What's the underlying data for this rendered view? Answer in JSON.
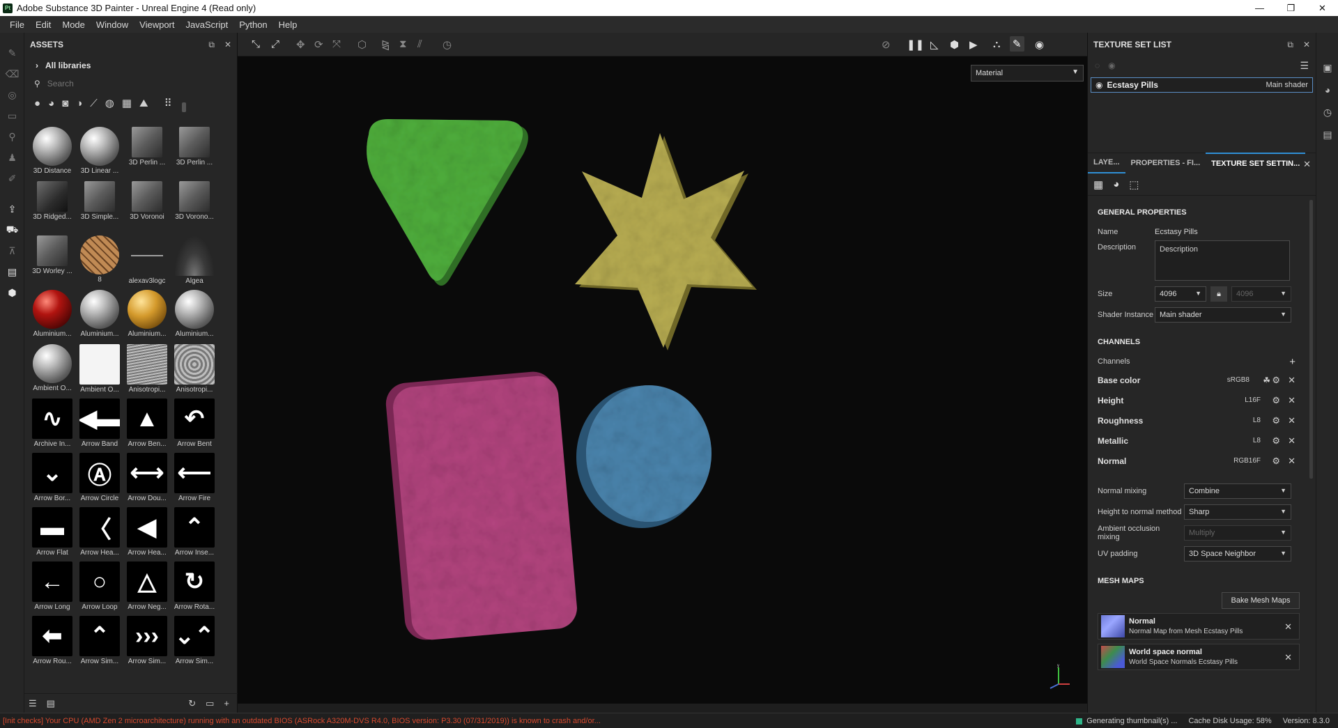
{
  "window": {
    "title": "Adobe Substance 3D Painter - Unreal Engine 4 (Read only)",
    "app_icon_text": "Pt"
  },
  "menu": [
    "File",
    "Edit",
    "Mode",
    "Window",
    "Viewport",
    "JavaScript",
    "Python",
    "Help"
  ],
  "assets": {
    "title": "ASSETS",
    "libraries_label": "All libraries",
    "search_placeholder": "Search",
    "items": [
      {
        "label": "3D Distance",
        "style": "sphere-chrome"
      },
      {
        "label": "3D Linear ...",
        "style": "sphere-chrome"
      },
      {
        "label": "3D Perlin ...",
        "style": "cube"
      },
      {
        "label": "3D Perlin ...",
        "style": "cube"
      },
      {
        "label": "3D Ridged...",
        "style": "cube dark"
      },
      {
        "label": "3D Simple...",
        "style": "cube"
      },
      {
        "label": "3D Voronoi",
        "style": "cube"
      },
      {
        "label": "3D Vorono...",
        "style": "cube"
      },
      {
        "label": "3D Worley ...",
        "style": "cube"
      },
      {
        "label": "8",
        "style": "sphere-diamond"
      },
      {
        "label": "alexav3logc",
        "style": "line"
      },
      {
        "label": "Algea",
        "style": "algea"
      },
      {
        "label": "Aluminium...",
        "style": "sphere-red"
      },
      {
        "label": "Aluminium...",
        "style": "sphere-chrome"
      },
      {
        "label": "Aluminium...",
        "style": "sphere-gold"
      },
      {
        "label": "Aluminium...",
        "style": "sphere-chrome"
      },
      {
        "label": "Ambient O...",
        "style": "sphere-chrome"
      },
      {
        "label": "Ambient O...",
        "style": "mask"
      },
      {
        "label": "Anisotropi...",
        "style": "lines"
      },
      {
        "label": "Anisotropi...",
        "style": "ring"
      },
      {
        "label": "Archive In...",
        "style": "white-shape",
        "glyph": "∿"
      },
      {
        "label": "Arrow Band",
        "style": "white-shape",
        "glyph": "◀▬"
      },
      {
        "label": "Arrow Ben...",
        "style": "white-shape",
        "glyph": "▲"
      },
      {
        "label": "Arrow Bent",
        "style": "white-shape",
        "glyph": "↶"
      },
      {
        "label": "Arrow Bor...",
        "style": "white-shape",
        "glyph": "⌄"
      },
      {
        "label": "Arrow Circle",
        "style": "white-shape",
        "glyph": "Ⓐ"
      },
      {
        "label": "Arrow Dou...",
        "style": "white-shape",
        "glyph": "⟷"
      },
      {
        "label": "Arrow Fire",
        "style": "white-shape",
        "glyph": "⟵"
      },
      {
        "label": "Arrow Flat",
        "style": "white-shape",
        "glyph": "▬"
      },
      {
        "label": "Arrow Hea...",
        "style": "white-shape",
        "glyph": "〈"
      },
      {
        "label": "Arrow Hea...",
        "style": "white-shape",
        "glyph": "◀"
      },
      {
        "label": "Arrow Inse...",
        "style": "white-shape",
        "glyph": "⌃"
      },
      {
        "label": "Arrow Long",
        "style": "white-shape",
        "glyph": "←"
      },
      {
        "label": "Arrow Loop",
        "style": "white-shape",
        "glyph": "○"
      },
      {
        "label": "Arrow Neg...",
        "style": "white-shape",
        "glyph": "△"
      },
      {
        "label": "Arrow Rota...",
        "style": "white-shape",
        "glyph": "↻"
      },
      {
        "label": "Arrow Rou...",
        "style": "white-shape",
        "glyph": "⬅"
      },
      {
        "label": "Arrow Sim...",
        "style": "white-shape",
        "glyph": "⌃"
      },
      {
        "label": "Arrow Sim...",
        "style": "white-shape",
        "glyph": "›››"
      },
      {
        "label": "Arrow Sim...",
        "style": "white-shape",
        "glyph": "⌄⌃"
      }
    ]
  },
  "viewport": {
    "mode": "Material"
  },
  "texture_set_list": {
    "title": "TEXTURE SET LIST",
    "set_name": "Ecstasy Pills",
    "set_shader": "Main shader"
  },
  "tabs": {
    "layers": "LAYE...",
    "properties": "PROPERTIES - FI...",
    "texture_set_settings": "TEXTURE SET SETTIN..."
  },
  "general": {
    "section": "GENERAL PROPERTIES",
    "name_label": "Name",
    "name_value": "Ecstasy Pills",
    "description_label": "Description",
    "description_value": "Description",
    "size_label": "Size",
    "size_value": "4096",
    "size_value_locked": "4096",
    "shader_label": "Shader Instance",
    "shader_value": "Main shader"
  },
  "channels": {
    "section": "CHANNELS",
    "channels_label": "Channels",
    "items": [
      {
        "name": "Base color",
        "format": "sRGB8"
      },
      {
        "name": "Height",
        "format": "L16F"
      },
      {
        "name": "Roughness",
        "format": "L8"
      },
      {
        "name": "Metallic",
        "format": "L8"
      },
      {
        "name": "Normal",
        "format": "RGB16F"
      }
    ],
    "normal_mixing_label": "Normal mixing",
    "normal_mixing_value": "Combine",
    "height_method_label": "Height to normal method",
    "height_method_value": "Sharp",
    "ao_mixing_label": "Ambient occlusion mixing",
    "ao_mixing_value": "Multiply",
    "uv_padding_label": "UV padding",
    "uv_padding_value": "3D Space Neighbor"
  },
  "mesh_maps": {
    "section": "MESH MAPS",
    "bake_button": "Bake Mesh Maps",
    "items": [
      {
        "title": "Normal",
        "subtitle": "Normal Map from Mesh Ecstasy Pills"
      },
      {
        "title": "World space normal",
        "subtitle": "World Space Normals Ecstasy Pills"
      }
    ]
  },
  "statusbar": {
    "error": "[Init checks] Your CPU (AMD Zen 2 microarchitecture) running with an outdated BIOS (ASRock A320M-DVS R4.0, BIOS version: P3.30 (07/31/2019)) is known to crash and/or...",
    "thumbnails": "Generating thumbnail(s) ...",
    "cache": "Cache Disk Usage:",
    "cache_value": "58%",
    "version": "Version: 8.3.0"
  },
  "colors": {
    "green_pill": "#4fae3c",
    "yellow_pill": "#b8ad52",
    "pink_pill": "#b2447e",
    "blue_pill": "#4a84ad",
    "accent": "#2f8fd6",
    "error": "#d84a2e"
  }
}
